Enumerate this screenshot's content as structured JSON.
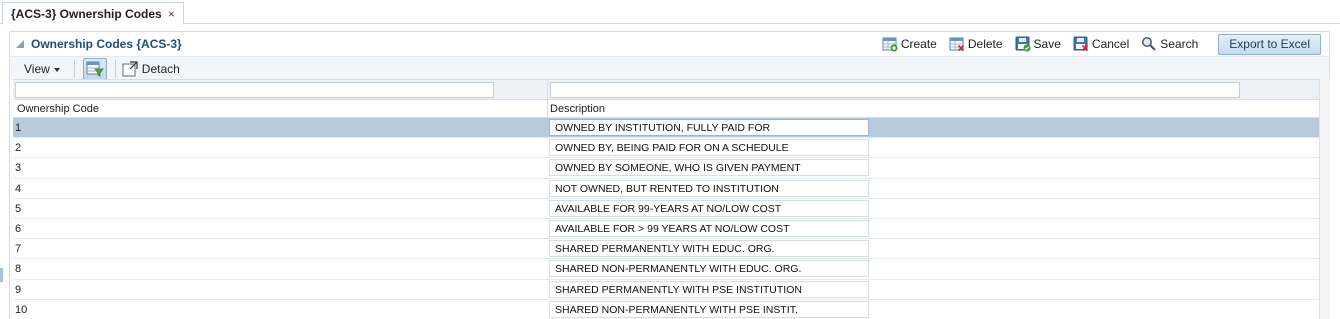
{
  "tab": {
    "label": "{ACS-3} Ownership Codes",
    "close_glyph": "×"
  },
  "panel": {
    "title": "Ownership Codes {ACS-3}",
    "actions": {
      "create": "Create",
      "delete": "Delete",
      "save": "Save",
      "cancel": "Cancel",
      "search": "Search",
      "export": "Export to Excel"
    }
  },
  "toolbar": {
    "view": "View",
    "detach": "Detach"
  },
  "table": {
    "columns": {
      "code": "Ownership Code",
      "description": "Description"
    },
    "rows": [
      {
        "code": "1",
        "description": "OWNED BY INSTITUTION, FULLY PAID FOR"
      },
      {
        "code": "2",
        "description": "OWNED BY, BEING PAID FOR ON A SCHEDULE"
      },
      {
        "code": "3",
        "description": "OWNED BY SOMEONE, WHO IS GIVEN PAYMENT"
      },
      {
        "code": "4",
        "description": "NOT OWNED, BUT RENTED TO INSTITUTION"
      },
      {
        "code": "5",
        "description": "AVAILABLE FOR 99-YEARS AT NO/LOW COST"
      },
      {
        "code": "6",
        "description": "AVAILABLE FOR > 99 YEARS AT NO/LOW COST"
      },
      {
        "code": "7",
        "description": "SHARED PERMANENTLY WITH EDUC. ORG."
      },
      {
        "code": "8",
        "description": "SHARED NON-PERMANENTLY WITH EDUC. ORG."
      },
      {
        "code": "9",
        "description": "SHARED PERMANENTLY WITH PSE INSTITUTION"
      },
      {
        "code": "10",
        "description": "SHARED NON-PERMANENTLY WITH PSE INSTIT."
      }
    ],
    "selected_row": "1"
  },
  "colors": {
    "accent": "#1d4f77",
    "selected_row": "#b7c9dc",
    "button_border": "#8eb1d1"
  }
}
